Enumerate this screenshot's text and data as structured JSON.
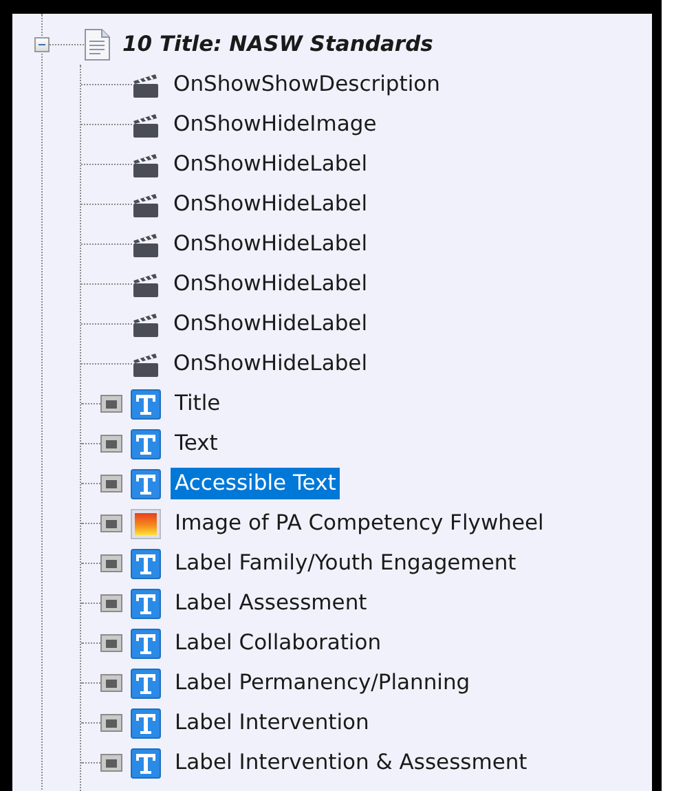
{
  "tree": {
    "label": "10 Title: NASW Standards",
    "expanded": true,
    "children": [
      {
        "kind": "action",
        "label": "OnShowShowDescription",
        "selected": false
      },
      {
        "kind": "action",
        "label": "OnShowHideImage",
        "selected": false
      },
      {
        "kind": "action",
        "label": "OnShowHideLabel",
        "selected": false
      },
      {
        "kind": "action",
        "label": "OnShowHideLabel",
        "selected": false
      },
      {
        "kind": "action",
        "label": "OnShowHideLabel",
        "selected": false
      },
      {
        "kind": "action",
        "label": "OnShowHideLabel",
        "selected": false
      },
      {
        "kind": "action",
        "label": "OnShowHideLabel",
        "selected": false
      },
      {
        "kind": "action",
        "label": "OnShowHideLabel",
        "selected": false
      },
      {
        "kind": "text",
        "label": "Title",
        "selected": false
      },
      {
        "kind": "text",
        "label": "Text",
        "selected": false
      },
      {
        "kind": "text",
        "label": "Accessible Text",
        "selected": true
      },
      {
        "kind": "image",
        "label": "Image of PA Competency Flywheel",
        "selected": false
      },
      {
        "kind": "text",
        "label": "Label Family/Youth Engagement",
        "selected": false
      },
      {
        "kind": "text",
        "label": "Label Assessment",
        "selected": false
      },
      {
        "kind": "text",
        "label": "Label Collaboration",
        "selected": false
      },
      {
        "kind": "text",
        "label": "Label Permanency/Planning",
        "selected": false
      },
      {
        "kind": "text",
        "label": "Label Intervention",
        "selected": false
      },
      {
        "kind": "text",
        "label": "Label Intervention & Assessment",
        "selected": false
      }
    ]
  }
}
